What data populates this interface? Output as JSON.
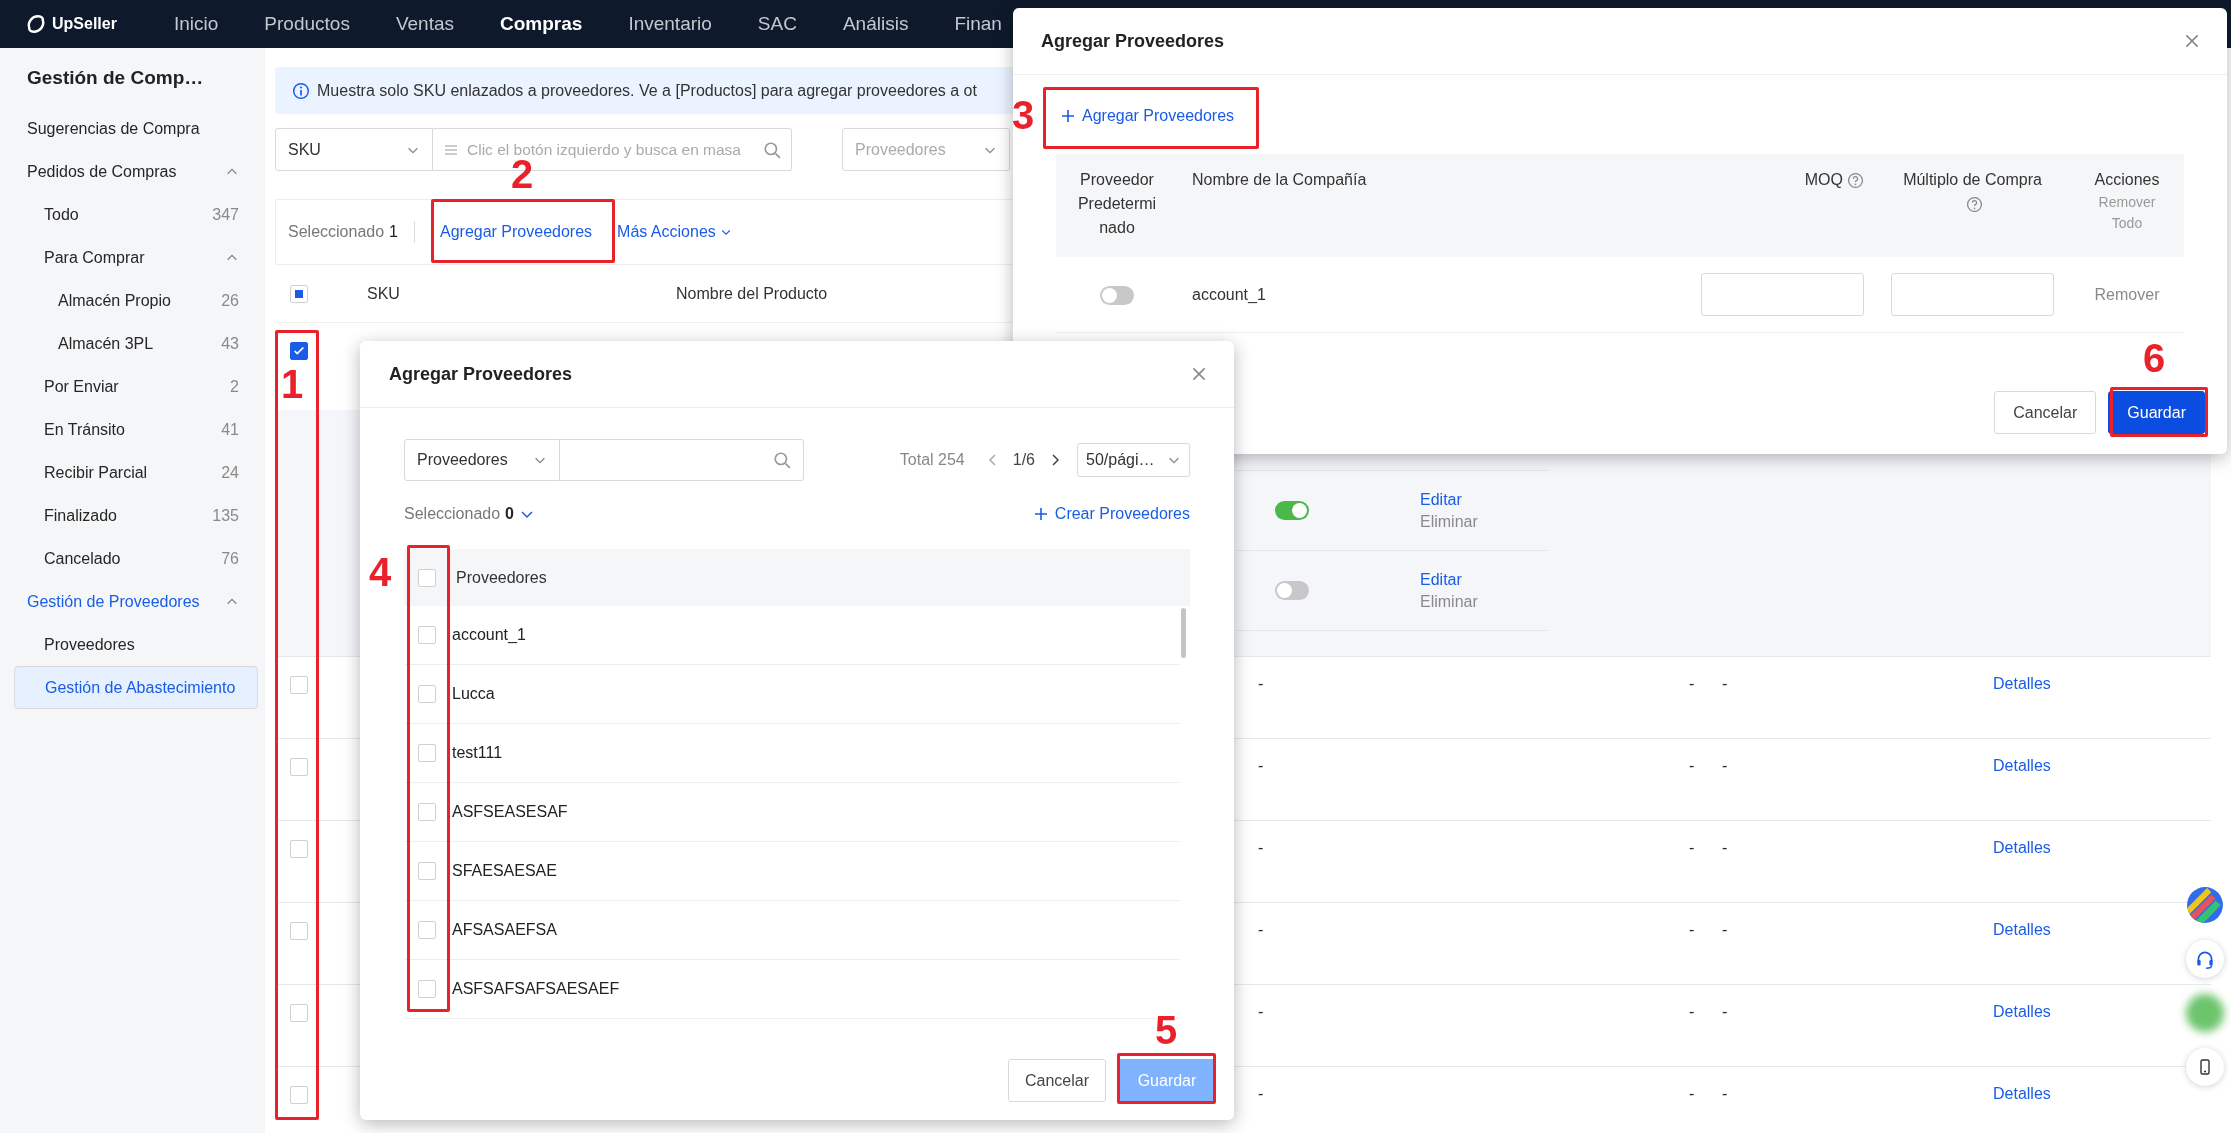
{
  "nav": {
    "logo": "UpSeller",
    "items": [
      {
        "label": "Inicio",
        "selected": false
      },
      {
        "label": "Productos",
        "selected": false
      },
      {
        "label": "Ventas",
        "selected": false
      },
      {
        "label": "Compras",
        "selected": true
      },
      {
        "label": "Inventario",
        "selected": false
      },
      {
        "label": "SAC",
        "selected": false
      },
      {
        "label": "Análisis",
        "selected": false
      },
      {
        "label": "Finan",
        "selected": false
      }
    ]
  },
  "sidebar": {
    "title": "Gestión de Comp…",
    "items": [
      {
        "label": "Sugerencias de Compra",
        "selected": false,
        "active": false
      },
      {
        "label": "Pedidos de Compras",
        "selected": false,
        "active": false,
        "expanded": true,
        "children": [
          {
            "label": "Todo",
            "count": "347",
            "selected": false
          },
          {
            "label": "Para Comprar",
            "selected": false,
            "expanded": true,
            "children": [
              {
                "label": "Almacén Propio",
                "count": "26",
                "selected": false
              },
              {
                "label": "Almacén 3PL",
                "count": "43",
                "selected": false
              }
            ]
          },
          {
            "label": "Por Enviar",
            "count": "2",
            "selected": false
          },
          {
            "label": "En Tránsito",
            "count": "41",
            "selected": false
          },
          {
            "label": "Recibir Parcial",
            "count": "24",
            "selected": false
          },
          {
            "label": "Finalizado",
            "count": "135",
            "selected": false
          },
          {
            "label": "Cancelado",
            "count": "76",
            "selected": false
          }
        ]
      },
      {
        "label": "Gestión de Proveedores",
        "selected": false,
        "active": true,
        "expanded": true,
        "children": [
          {
            "label": "Proveedores",
            "selected": false
          },
          {
            "label": "Gestión de Abastecimiento",
            "selected": true
          }
        ]
      }
    ]
  },
  "notice": {
    "text": "Muestra solo SKU enlazados a proveedores. Ve a [Productos] para agregar proveedores a ot"
  },
  "filters": {
    "field_select": "SKU",
    "search": {
      "placeholder": "Clic el botón izquierdo y busca en masa"
    },
    "supplier_select": {
      "placeholder": "Proveedores"
    }
  },
  "toolbar": {
    "selected_label": "Seleccionado",
    "selected_count": "1",
    "actions": [
      {
        "label": "Agregar Proveedores",
        "dropdown": false
      },
      {
        "label": "Más Acciones",
        "dropdown": true
      }
    ]
  },
  "table": {
    "select_all": {
      "indeterminate": true
    },
    "columns": [
      "SKU",
      "Nombre del Producto"
    ],
    "rows": [
      {
        "checked": true,
        "expanded": true,
        "suppliers": [
          {
            "default": true,
            "edit": "Editar",
            "delete": "Eliminar"
          },
          {
            "default": false,
            "edit": "Editar",
            "delete": "Eliminar"
          }
        ]
      },
      {
        "checked": false,
        "expanded": false,
        "cells": [
          "-",
          "-",
          "-"
        ],
        "action": "Detalles"
      },
      {
        "checked": false,
        "expanded": false,
        "cells": [
          "-",
          "-",
          "-"
        ],
        "action": "Detalles"
      },
      {
        "checked": false,
        "expanded": false,
        "cells": [
          "-",
          "-",
          "-"
        ],
        "action": "Detalles"
      },
      {
        "checked": false,
        "expanded": false,
        "cells": [
          "-",
          "-",
          "-"
        ],
        "action": "Detalles"
      },
      {
        "checked": false,
        "expanded": false,
        "cells": [
          "-",
          "-",
          "-"
        ],
        "action": "Detalles"
      },
      {
        "checked": false,
        "expanded": false,
        "cells": [
          "-",
          "-",
          "-"
        ],
        "action": "Detalles"
      }
    ]
  },
  "supplier_dialog": {
    "title": "Agregar Proveedores",
    "add_link": "Agregar Proveedores",
    "columns": [
      {
        "label": "Proveedor Predeterminado"
      },
      {
        "label": "Nombre de la Compañía"
      },
      {
        "label": "MOQ",
        "help": true
      },
      {
        "label": "Múltiplo de Compra",
        "help": true
      },
      {
        "label": "Acciones",
        "sub_link": "Remover Todo"
      }
    ],
    "rows": [
      {
        "default": false,
        "company": "account_1",
        "action": "Remover"
      }
    ],
    "buttons": [
      {
        "label": "Cancelar",
        "kind": "secondary"
      },
      {
        "label": "Guardar",
        "kind": "primary",
        "disabled": false
      }
    ]
  },
  "picker_dialog": {
    "title": "Agregar Proveedores",
    "search": {
      "field": "Proveedores"
    },
    "total": "Total 254",
    "page": "1/6",
    "page_size": "50/pági…",
    "selected_label": "Seleccionado",
    "selected_count": "0",
    "create_link": "Crear Proveedores",
    "list_header": {
      "label": "Proveedores",
      "checked": false
    },
    "items": [
      {
        "name": "account_1",
        "checked": false
      },
      {
        "name": "Lucca",
        "checked": false
      },
      {
        "name": "test111",
        "checked": false
      },
      {
        "name": "ASFSEASESAF",
        "checked": false
      },
      {
        "name": "SFAESAESAE",
        "checked": false
      },
      {
        "name": "AFSASAEFSA",
        "checked": false
      },
      {
        "name": "ASFSAFSAFSAESAEF",
        "checked": false
      }
    ],
    "buttons": [
      {
        "label": "Cancelar",
        "kind": "secondary"
      },
      {
        "label": "Guardar",
        "kind": "primary",
        "disabled": true
      }
    ]
  },
  "annotations": [
    {
      "number": "1"
    },
    {
      "number": "2"
    },
    {
      "number": "3"
    },
    {
      "number": "4"
    },
    {
      "number": "5"
    },
    {
      "number": "6"
    }
  ]
}
